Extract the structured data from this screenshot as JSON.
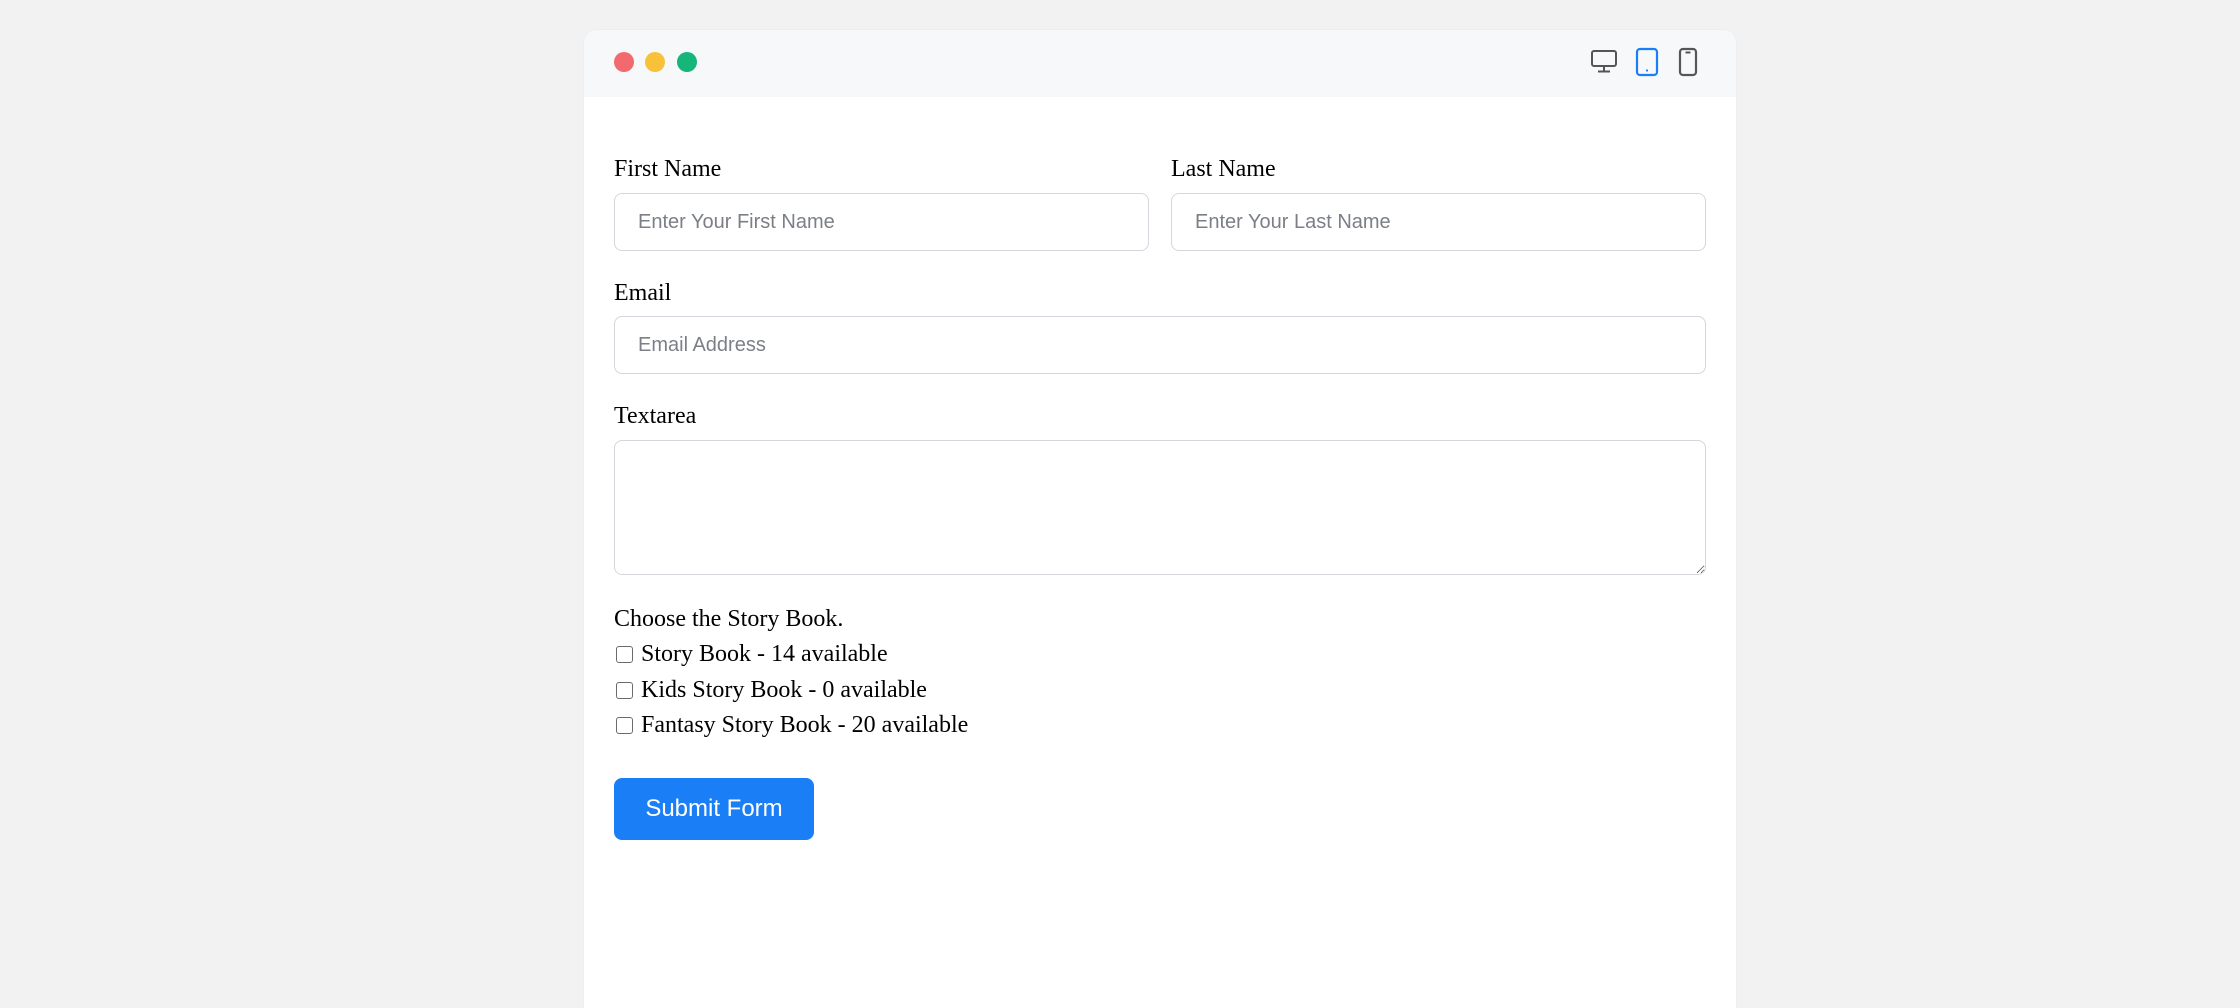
{
  "window": {
    "device_icons": [
      "desktop-icon",
      "tablet-icon",
      "mobile-icon"
    ],
    "active_device": "tablet"
  },
  "form": {
    "first_name": {
      "label": "First Name",
      "placeholder": "Enter Your First Name",
      "value": ""
    },
    "last_name": {
      "label": "Last Name",
      "placeholder": "Enter Your Last Name",
      "value": ""
    },
    "email": {
      "label": "Email",
      "placeholder": "Email Address",
      "value": ""
    },
    "textarea": {
      "label": "Textarea",
      "value": ""
    },
    "books": {
      "prompt": "Choose the Story Book.",
      "options": [
        {
          "label": "Story Book - 14 available",
          "checked": false
        },
        {
          "label": "Kids Story Book - 0 available",
          "checked": false
        },
        {
          "label": "Fantasy Story Book - 20 available",
          "checked": false
        }
      ]
    },
    "submit_label": "Submit Form"
  },
  "colors": {
    "accent": "#1a7ef7",
    "dot_red": "#f26a6d",
    "dot_yellow": "#f8c13a",
    "dot_green": "#16b57a"
  }
}
